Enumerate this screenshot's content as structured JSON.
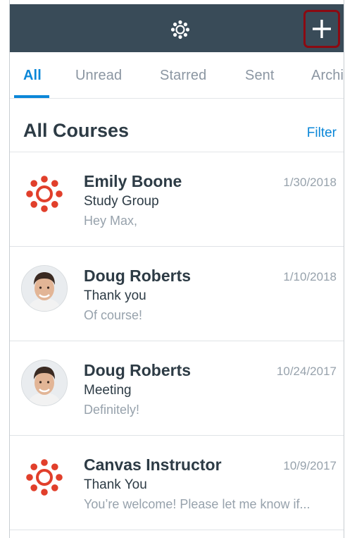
{
  "header": {
    "logo_icon": "canvas-logo-icon",
    "compose_icon": "plus-icon",
    "compose_highlight_color": "#8b0a12",
    "bar_color": "#394b58"
  },
  "tabs": [
    {
      "label": "All",
      "active": true
    },
    {
      "label": "Unread",
      "active": false
    },
    {
      "label": "Starred",
      "active": false
    },
    {
      "label": "Sent",
      "active": false
    },
    {
      "label": "Archi",
      "active": false
    }
  ],
  "section": {
    "title": "All Courses",
    "filter_label": "Filter"
  },
  "messages": [
    {
      "sender": "Emily Boone",
      "subject": "Study Group",
      "preview": "Hey Max,",
      "date": "1/30/2018",
      "avatar": "canvas-logo-icon"
    },
    {
      "sender": "Doug Roberts",
      "subject": "Thank you",
      "preview": "Of course!",
      "date": "1/10/2018",
      "avatar": "user-photo"
    },
    {
      "sender": "Doug Roberts",
      "subject": "Meeting",
      "preview": "Definitely!",
      "date": "10/24/2017",
      "avatar": "user-photo"
    },
    {
      "sender": "Canvas Instructor",
      "subject": "Thank You",
      "preview": "You’re welcome! Please let me know if...",
      "date": "10/9/2017",
      "avatar": "canvas-logo-icon"
    }
  ],
  "colors": {
    "accent": "#0b87d8",
    "canvas_red": "#e13f2b",
    "text_dark": "#2d3b45",
    "text_muted": "#97a2ac"
  }
}
